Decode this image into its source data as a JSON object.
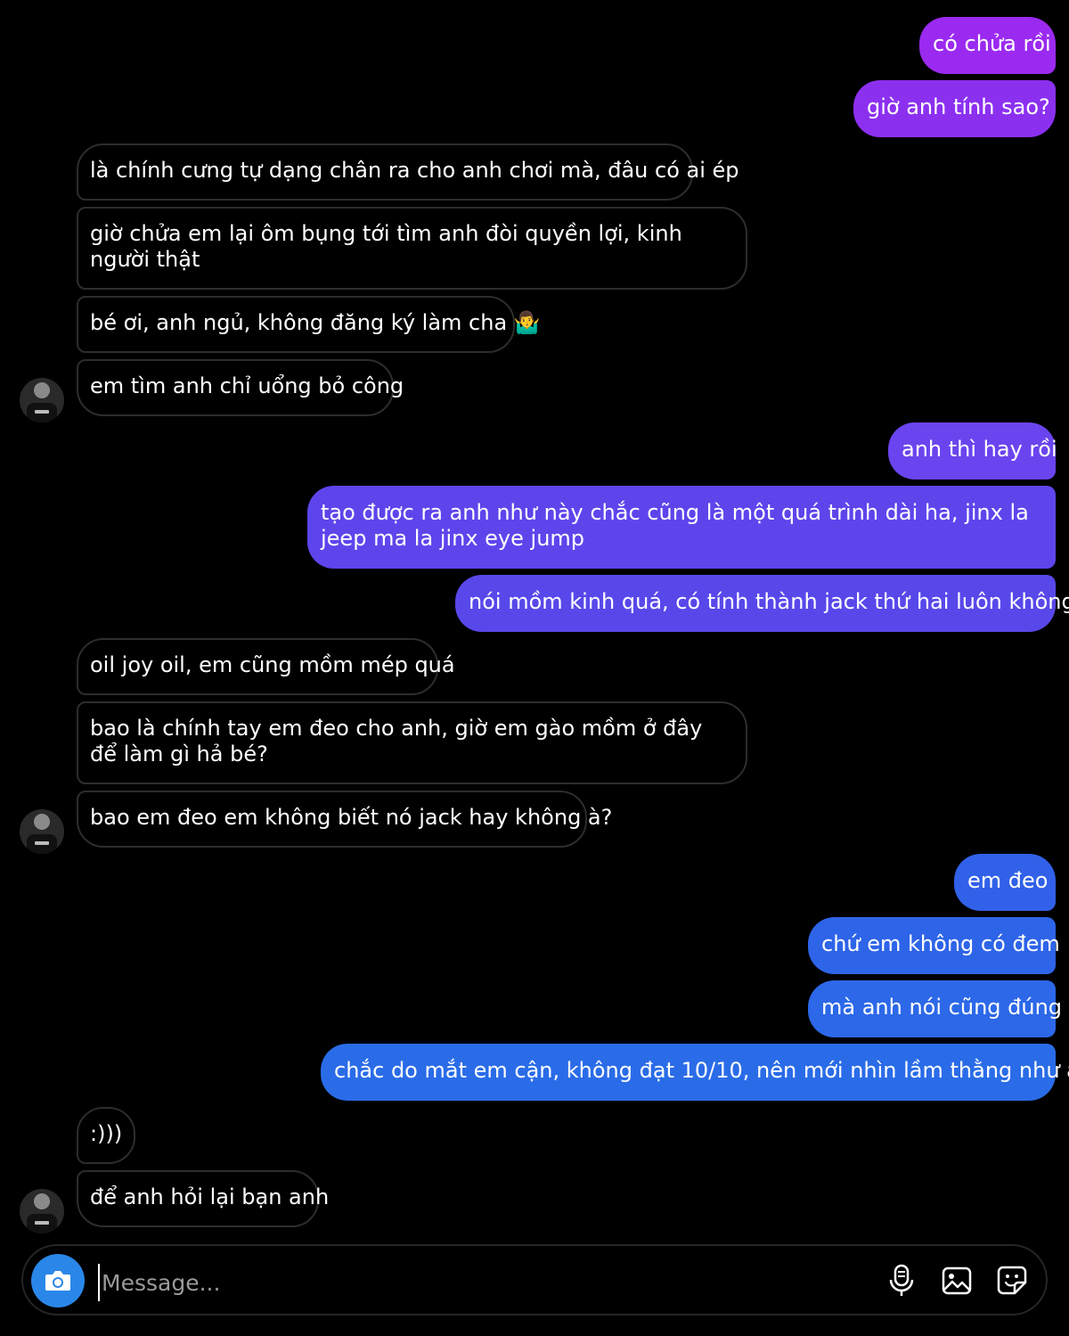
{
  "messages": [
    {
      "side": "out",
      "text": "có chửa rồi",
      "color": "#9b2af0"
    },
    {
      "side": "out",
      "text": "giờ anh tính sao?",
      "color": "#8c30f0"
    },
    {
      "side": "in",
      "text": "là chính cưng tự dạng chân ra cho anh chơi mà, đâu có ai ép"
    },
    {
      "side": "in",
      "text": "giờ chửa em lại ôm bụng tới tìm anh đòi quyền lợi, kinh người thật"
    },
    {
      "side": "in",
      "text": "bé ơi, anh ngủ, không đăng ký làm cha 🤷‍♂️"
    },
    {
      "side": "in",
      "text": "em tìm anh chỉ uổng bỏ công"
    },
    {
      "side": "out",
      "text": "anh thì hay rồi",
      "color": "#6a44ee"
    },
    {
      "side": "out",
      "text": "tạo được ra anh như này chắc cũng là một quá trình dài ha, jinx la jeep ma la jinx eye jump",
      "color": "#5d45ec"
    },
    {
      "side": "out",
      "text": "nói mồm kinh quá, có tính thành jack thứ hai luôn không?",
      "color": "#5848ea"
    },
    {
      "side": "in",
      "text": "oil joy oil, em cũng mồm mép quá"
    },
    {
      "side": "in",
      "text": "bao là chính tay em đeo cho anh, giờ em gào mồm ở đây để làm gì hả bé?"
    },
    {
      "side": "in",
      "text": "bao em đeo em không biết nó jack hay không à?"
    },
    {
      "side": "out",
      "text": "em đeo",
      "color": "#3161e8"
    },
    {
      "side": "out",
      "text": "chứ em không có đem",
      "color": "#2e64e8"
    },
    {
      "side": "out",
      "text": "mà anh nói cũng đúng",
      "color": "#2c68e8"
    },
    {
      "side": "out",
      "text": "chắc do mắt em cận, không đạt 10/10, nên mới nhìn lầm thằng như anh",
      "color": "#2a6ce8"
    },
    {
      "side": "in",
      "text": ":)))"
    },
    {
      "side": "in",
      "text": "để anh hỏi lại bạn anh"
    }
  ],
  "composer": {
    "placeholder": "Message...",
    "camera_color": "#2a87e8",
    "icons": [
      "camera-icon",
      "microphone-icon",
      "gallery-icon",
      "sticker-icon"
    ]
  }
}
